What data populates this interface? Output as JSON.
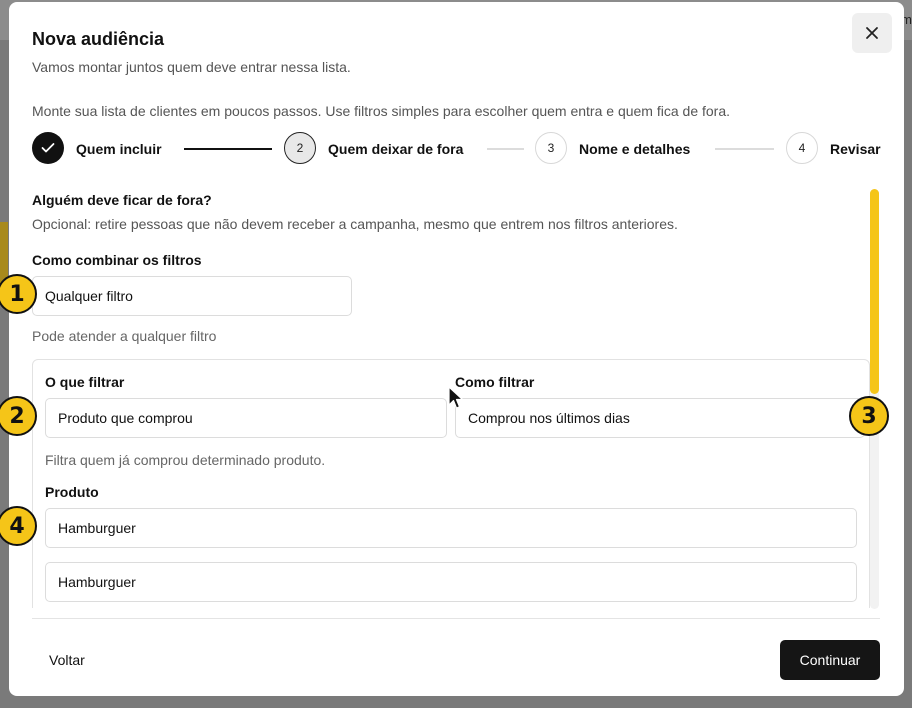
{
  "background": {
    "edge_text": "m"
  },
  "modal": {
    "title": "Nova audiência",
    "subtitle": "Vamos montar juntos quem deve entrar nessa lista.",
    "intro": "Monte sua lista de clientes em poucos passos. Use filtros simples para escolher quem entra e quem fica de fora.",
    "close_icon": "close-icon"
  },
  "stepper": {
    "steps": [
      {
        "number": "",
        "label": "Quem incluir",
        "state": "done",
        "icon": "check-icon"
      },
      {
        "number": "2",
        "label": "Quem deixar de fora",
        "state": "current"
      },
      {
        "number": "3",
        "label": "Nome e detalhes",
        "state": "future"
      },
      {
        "number": "4",
        "label": "Revisar",
        "state": "future"
      }
    ]
  },
  "exclusion": {
    "title": "Alguém deve ficar de fora?",
    "description": "Opcional: retire pessoas que não devem receber a campanha, mesmo que entrem nos filtros anteriores.",
    "combine_label": "Como combinar os filtros",
    "combine_value": "Qualquer filtro",
    "combine_helper": "Pode atender a qualquer filtro",
    "filter": {
      "what_label": "O que filtrar",
      "what_value": "Produto que comprou",
      "how_label": "Como filtrar",
      "how_value": "Comprou nos últimos dias",
      "helper": "Filtra quem já comprou determinado produto.",
      "product_label": "Produto",
      "product_values": [
        "Hamburguer",
        "Hamburguer"
      ]
    }
  },
  "footer": {
    "back_label": "Voltar",
    "continue_label": "Continuar"
  },
  "markers": [
    "1",
    "2",
    "3",
    "4"
  ],
  "colors": {
    "accent": "#f5c518",
    "primary_button": "#151515",
    "overlay": "#7a7a7a"
  }
}
